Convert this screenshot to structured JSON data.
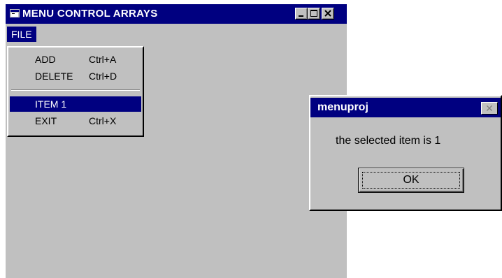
{
  "window": {
    "title": "MENU CONTROL ARRAYS",
    "controls": [
      "minimize-icon",
      "maximize-icon",
      "close-icon"
    ]
  },
  "menubar": {
    "file_label": "FILE"
  },
  "file_menu": {
    "items": [
      {
        "label": "ADD",
        "shortcut": "Ctrl+A"
      },
      {
        "label": "DELETE",
        "shortcut": "Ctrl+D"
      },
      {
        "label": "ITEM 1",
        "shortcut": ""
      },
      {
        "label": "EXIT",
        "shortcut": "Ctrl+X"
      }
    ],
    "selected": "ITEM 1"
  },
  "dialog": {
    "title": "menuproj",
    "message": "the selected item is  1",
    "ok_label": "OK"
  },
  "colors": {
    "titlebar": "#000080",
    "face": "#c0c0c0",
    "highlight": "#000080"
  }
}
